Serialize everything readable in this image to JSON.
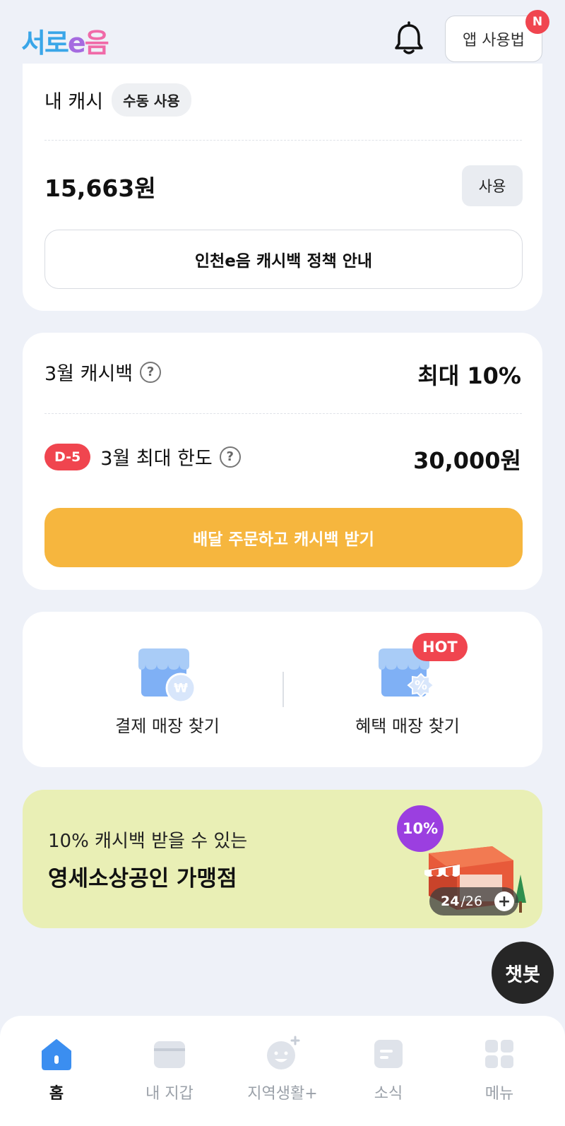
{
  "header": {
    "logo": [
      "서로",
      "e",
      "음"
    ],
    "guide_label": "앱 사용법",
    "notification_badge": "N"
  },
  "cash": {
    "title": "내 캐시",
    "chip": "수동 사용",
    "balance": "15,663원",
    "use_label": "사용",
    "policy_label": "인천e음 캐시백 정책 안내"
  },
  "cashback": {
    "month_label": "3월 캐시백",
    "month_value": "최대 10%",
    "d_badge": "D-5",
    "limit_label": "3월 최대 한도",
    "limit_value": "30,000원",
    "help_glyph": "?",
    "cta_label": "배달 주문하고 캐시백 받기"
  },
  "stores": {
    "payment_label": "결제 매장 찾기",
    "payment_badge_glyph": "₩",
    "benefit_label": "혜택 매장 찾기",
    "benefit_badge_glyph": "%",
    "hot_label": "HOT"
  },
  "banner": {
    "line1": "10% 캐시백 받을 수 있는",
    "line2": "영세소상공인 가맹점",
    "pct_badge": "10%",
    "pager_current": "24",
    "pager_total": "/26",
    "pager_plus": "+"
  },
  "chatbot_label": "챗봇",
  "nav": {
    "items": [
      {
        "label": "홈",
        "icon": "home-icon",
        "active": true
      },
      {
        "label": "내 지갑",
        "icon": "wallet-icon",
        "active": false
      },
      {
        "label": "지역생활+",
        "icon": "smile-plus-icon",
        "active": false
      },
      {
        "label": "소식",
        "icon": "news-icon",
        "active": false
      },
      {
        "label": "메뉴",
        "icon": "grid-menu-icon",
        "active": false
      }
    ]
  },
  "colors": {
    "accent_orange": "#f6b63e",
    "alert_red": "#f0454f",
    "active_blue": "#3b8ef0",
    "banner_bg": "#e9efb5"
  }
}
